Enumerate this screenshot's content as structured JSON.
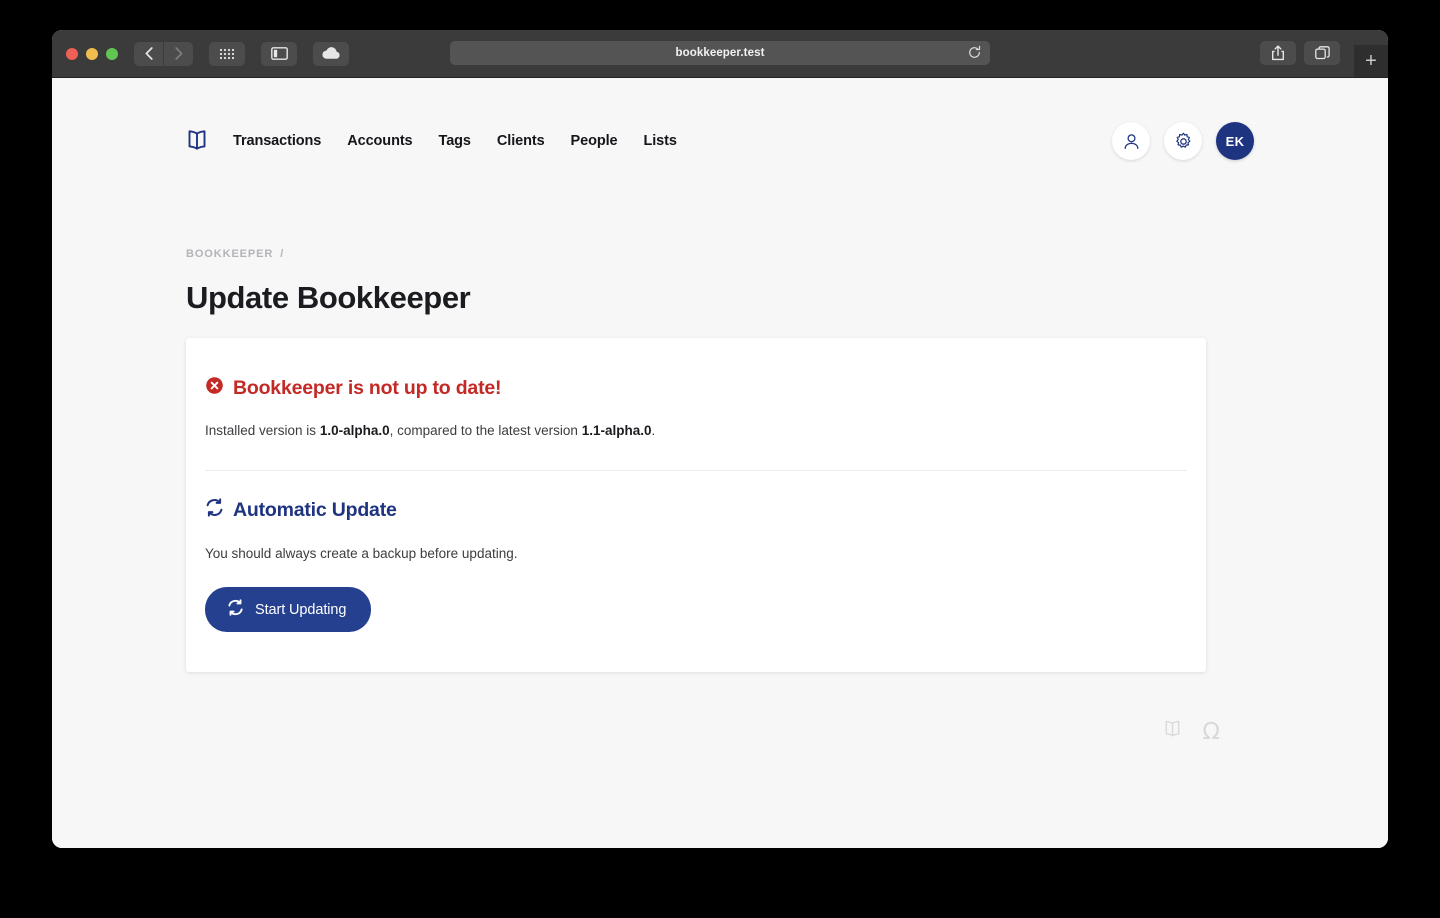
{
  "browser": {
    "url": "bookkeeper.test",
    "traffic_lights": [
      "close",
      "minimize",
      "zoom"
    ],
    "toolbar_icons": [
      "back-icon",
      "forward-icon",
      "grid-icon",
      "sidebar-icon",
      "cloud-icon"
    ],
    "right_icons": [
      "share-icon",
      "tabs-icon"
    ],
    "new_tab_label": "+",
    "reload_icon": "reload-icon"
  },
  "nav": {
    "logo": "book-logo-icon",
    "links": [
      {
        "label": "Transactions"
      },
      {
        "label": "Accounts"
      },
      {
        "label": "Tags"
      },
      {
        "label": "Clients"
      },
      {
        "label": "People"
      },
      {
        "label": "Lists"
      }
    ],
    "actions": [
      {
        "icon": "user-icon"
      },
      {
        "icon": "gear-icon"
      }
    ],
    "avatar": {
      "initials": "EK",
      "color": "#1f3480"
    }
  },
  "header": {
    "breadcrumb": {
      "root": "BOOKKEEPER",
      "separator": "/"
    },
    "title": "Update Bookkeeper"
  },
  "card": {
    "alert": {
      "icon": "error-circle-icon",
      "title": "Bookkeeper is not up to date!",
      "color": "#c32a26"
    },
    "version": {
      "prefix": "Installed version is ",
      "installed": "1.0-alpha.0",
      "middle": ", compared to the latest version ",
      "latest": "1.1-alpha.0",
      "suffix": "."
    },
    "section": {
      "icon": "sync-icon",
      "title": "Automatic Update",
      "note": "You should always create a backup before updating.",
      "button": {
        "icon": "sync-icon",
        "label": "Start Updating",
        "color": "#25408f"
      }
    }
  },
  "footer": {
    "icons": [
      "book-logo-icon",
      "omega-icon"
    ],
    "omega_glyph": "Ω"
  },
  "colors": {
    "page_background": "#f7f7f8",
    "card_background": "#ffffff",
    "brand_navy": "#1f3480",
    "alert_red": "#c32a26",
    "title_black": "#1b1c1f"
  }
}
